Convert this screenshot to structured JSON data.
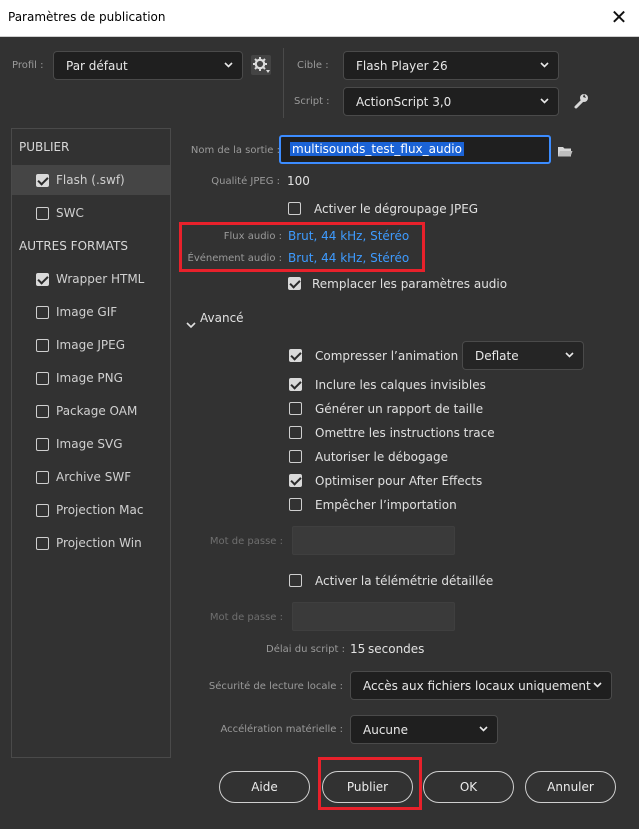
{
  "window": {
    "title": "Paramètres de publication",
    "close_glyph": "✕"
  },
  "profile": {
    "label": "Profil :",
    "value": "Par défaut"
  },
  "target": {
    "label": "Cible :",
    "value": "Flash Player 26"
  },
  "script": {
    "label": "Script :",
    "value": "ActionScript 3,0"
  },
  "sidebar": {
    "publish_header": "PUBLIER",
    "other_header": "AUTRES FORMATS",
    "items": [
      {
        "label": "Flash (.swf)",
        "checked": true
      },
      {
        "label": "SWC",
        "checked": false
      },
      {
        "label": "Wrapper HTML",
        "checked": true
      },
      {
        "label": "Image GIF",
        "checked": false
      },
      {
        "label": "Image JPEG",
        "checked": false
      },
      {
        "label": "Image PNG",
        "checked": false
      },
      {
        "label": "Package OAM",
        "checked": false
      },
      {
        "label": "Image SVG",
        "checked": false
      },
      {
        "label": "Archive SWF",
        "checked": false
      },
      {
        "label": "Projection Mac",
        "checked": false
      },
      {
        "label": "Projection Win",
        "checked": false
      }
    ]
  },
  "output": {
    "label": "Nom de la sortie :",
    "value": "multisounds_test_flux_audio"
  },
  "jpeg_quality": {
    "label": "Qualité JPEG :",
    "value": "100"
  },
  "jpeg_deblock": {
    "label": "Activer le dégroupage JPEG",
    "checked": false
  },
  "audio_stream": {
    "label": "Flux audio :",
    "value": "Brut, 44 kHz, Stéréo"
  },
  "audio_event": {
    "label": "Événement audio :",
    "value": "Brut, 44 kHz, Stéréo"
  },
  "override_audio": {
    "label": "Remplacer les paramètres audio",
    "checked": true
  },
  "advanced": {
    "label": "Avancé"
  },
  "options": [
    {
      "label": "Compresser l’animation",
      "checked": true
    },
    {
      "label": "Inclure les calques invisibles",
      "checked": true
    },
    {
      "label": "Générer un rapport de taille",
      "checked": false
    },
    {
      "label": "Omettre les instructions trace",
      "checked": false
    },
    {
      "label": "Autoriser le débogage",
      "checked": false
    },
    {
      "label": "Optimiser pour After Effects",
      "checked": true
    },
    {
      "label": "Empêcher l’importation",
      "checked": false
    }
  ],
  "compression": {
    "value": "Deflate"
  },
  "password1": {
    "label": "Mot de passe :",
    "value": ""
  },
  "telemetry": {
    "label": "Activer la télémétrie détaillée",
    "checked": false
  },
  "password2": {
    "label": "Mot de passe :",
    "value": ""
  },
  "script_delay": {
    "label": "Délai du script :",
    "value": "15",
    "unit": "secondes"
  },
  "local_security": {
    "label": "Sécurité de lecture locale :",
    "value": "Accès aux fichiers locaux uniquement"
  },
  "hw_accel": {
    "label": "Accélération matérielle :",
    "value": "Aucune"
  },
  "buttons": {
    "help": "Aide",
    "publish": "Publier",
    "ok": "OK",
    "cancel": "Annuler"
  },
  "colors": {
    "panel_bg": "#323232",
    "link": "#3e9bff",
    "highlight_box": "#e8212b",
    "focus_border": "#3c8cff",
    "selection": "#1b63d6"
  }
}
